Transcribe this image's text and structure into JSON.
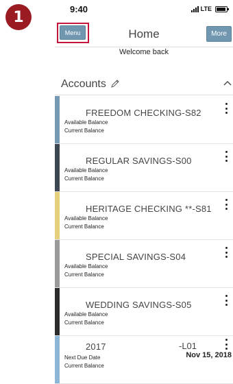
{
  "step_badge": "1",
  "status_bar": {
    "time": "9:40",
    "network": "LTE"
  },
  "header": {
    "menu_label": "Menu",
    "title": "Home",
    "more_label": "More",
    "welcome": "Welcome back"
  },
  "accounts_section": {
    "title": "Accounts"
  },
  "accounts": [
    {
      "name": "FREEDOM CHECKING-S82",
      "line1": "Available Balance",
      "line2": "Current Balance",
      "bar_color": "#7599b3"
    },
    {
      "name": "REGULAR SAVINGS-S00",
      "line1": "Available Balance",
      "line2": "Current Balance",
      "bar_color": "#3c4752"
    },
    {
      "name": "HERITAGE CHECKING **-S81",
      "line1": "Available Balance",
      "line2": "Current Balance",
      "bar_color": "#e5cf7d"
    },
    {
      "name": "SPECIAL SAVINGS-S04",
      "line1": "Available Balance",
      "line2": "Current Balance",
      "bar_color": "#9a9a9a"
    },
    {
      "name": "WEDDING SAVINGS-S05",
      "line1": "Available Balance",
      "line2": "Current Balance",
      "bar_color": "#2c2c2c"
    },
    {
      "name": "2017",
      "suffix": "-L01",
      "date": "Nov 15, 2018",
      "line1": "Next Due Date",
      "line2": "Current Balance",
      "bar_color": "#8cb6d8"
    }
  ]
}
